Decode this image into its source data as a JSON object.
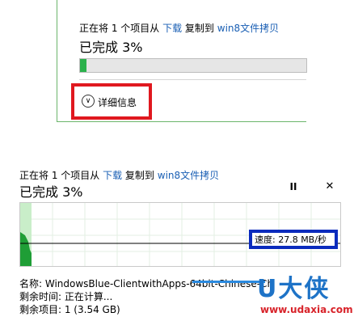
{
  "top_dialog": {
    "status_prefix": "正在将 1 个项目从 ",
    "source": "下载",
    "status_mid": " 复制到 ",
    "destination": "win8文件拷贝",
    "progress_title": "已完成 3%",
    "progress_value": 0.03,
    "details_label": "详细信息"
  },
  "bottom_dialog": {
    "status_prefix": "正在将 1 个项目从 ",
    "source": "下载",
    "status_mid": " 复制到 ",
    "destination": "win8文件拷贝",
    "progress_title": "已完成 3%",
    "pause_label": "II",
    "close_label": "✕",
    "speed_text": "速度: 27.8 MB/秒",
    "name_text": "名称: WindowsBlue-ClientwithApps-64bit-Chinese-Ch",
    "time_text": "剩余时间: 正在计算...",
    "items_text": "剩余项目: 1 (3.54 GB)"
  },
  "watermark": {
    "brand": "U大侠",
    "url": "www.udaxia.com"
  },
  "colors": {
    "progress_green": "#2bb24c",
    "highlight_red": "#e0181f",
    "highlight_blue": "#0b2bbd",
    "link_blue": "#1a5fb4"
  }
}
